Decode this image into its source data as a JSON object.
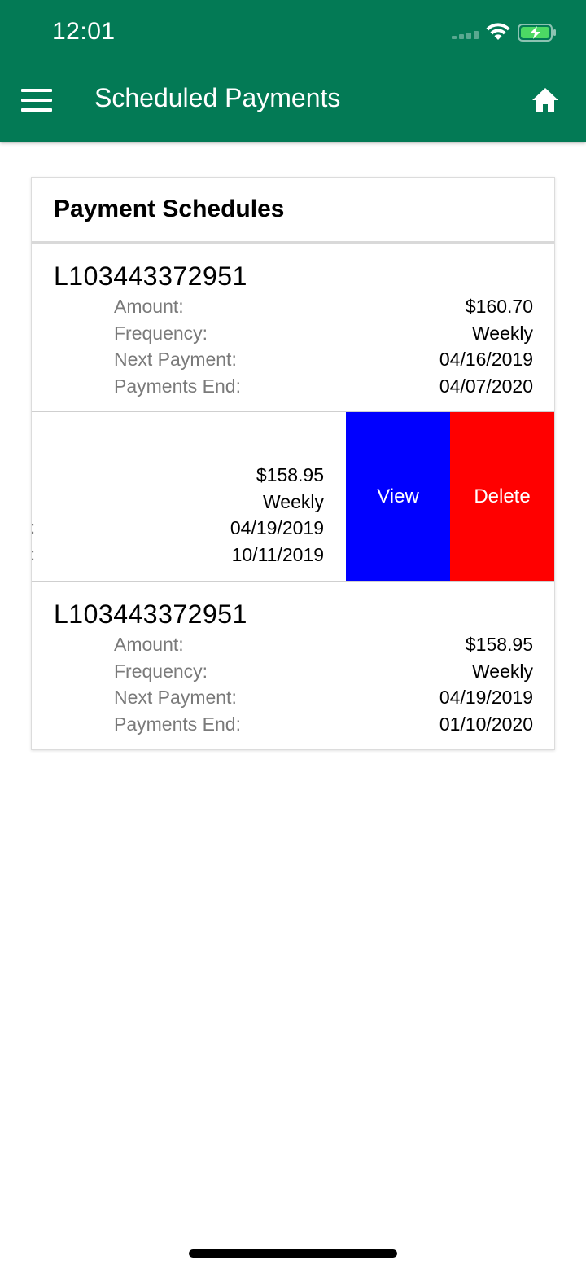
{
  "status_bar": {
    "time": "12:01"
  },
  "app_bar": {
    "title": "Scheduled Payments"
  },
  "card": {
    "title": "Payment Schedules",
    "rows": [
      {
        "loan_id": "L103443372951",
        "labels": [
          "Amount:",
          "Frequency:",
          "Next Payment:",
          "Payments End:"
        ],
        "amount": "$160.70",
        "frequency": "Weekly",
        "next_payment": "04/16/2019",
        "payments_end": "04/07/2020"
      },
      {
        "colons": [
          ":",
          ":"
        ],
        "amount": "$158.95",
        "frequency": "Weekly",
        "next_payment": "04/19/2019",
        "payments_end": "10/11/2019",
        "actions": {
          "view": "View",
          "delete": "Delete"
        }
      },
      {
        "loan_id": "L103443372951",
        "labels": [
          "Amount:",
          "Frequency:",
          "Next Payment:",
          "Payments End:"
        ],
        "amount": "$158.95",
        "frequency": "Weekly",
        "next_payment": "04/19/2019",
        "payments_end": "01/10/2020"
      }
    ]
  },
  "colors": {
    "app_bar": "#037a55",
    "view_button": "#0000ff",
    "delete_button": "#ff0000"
  },
  "icons": [
    "menu-icon",
    "home-icon",
    "wifi-icon",
    "battery-charging-icon",
    "cellular-signal-icon"
  ]
}
